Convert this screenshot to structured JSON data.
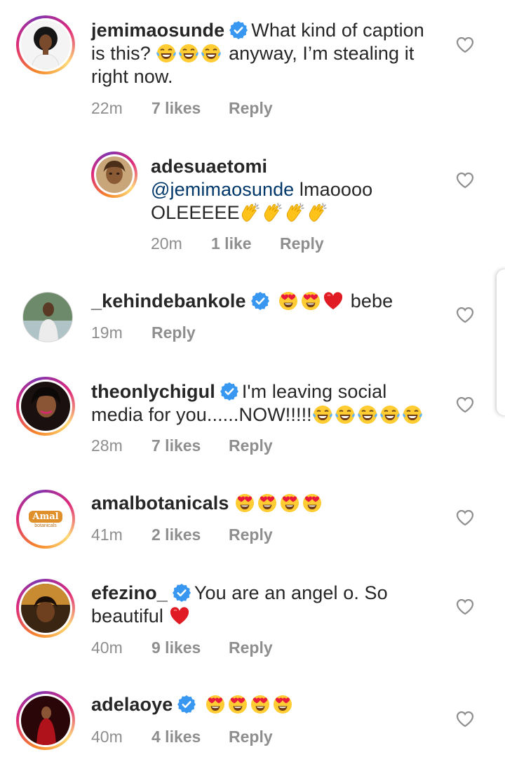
{
  "comments": [
    {
      "username": "jemimaosunde",
      "verified": true,
      "text": "What kind of caption is this? 😂😂😂 anyway, I’m stealing it right now.",
      "text_line1": "What kind of caption",
      "text_line2_a": "is this?",
      "text_line2_b": "anyway, I’m stealing it",
      "text_line3": "right now.",
      "time": "22m",
      "likes": "7 likes",
      "reply": "Reply",
      "emojis": [
        "tears-of-joy",
        "tears-of-joy",
        "tears-of-joy"
      ]
    },
    {
      "username": "adesuaetomi",
      "verified": false,
      "mention": "@jemimaosunde",
      "text": "lmaoooo OLEEEEE👏👏👏👏",
      "text_a": " lmaoooo",
      "text_b": "OLEEEEE",
      "time": "20m",
      "likes": "1 like",
      "reply": "Reply",
      "emojis": [
        "clapping",
        "clapping",
        "clapping",
        "clapping"
      ]
    },
    {
      "username": "_kehindebankole",
      "verified": true,
      "text": "😍😍❤️ bebe",
      "text_a": "bebe",
      "time": "19m",
      "likes": "",
      "reply": "Reply",
      "emojis": [
        "heart-eyes",
        "heart-eyes",
        "red-heart"
      ]
    },
    {
      "username": "theonlychigul",
      "verified": true,
      "text": "I'm leaving social media for you......NOW!!!!!😂😂😂😂😂",
      "text_line1": "I'm leaving social",
      "text_line2": "media for you......NOW!!!!!",
      "time": "28m",
      "likes": "7 likes",
      "reply": "Reply",
      "emojis": [
        "tears-of-joy",
        "tears-of-joy",
        "tears-of-joy",
        "tears-of-joy",
        "tears-of-joy"
      ]
    },
    {
      "username": "amalbotanicals",
      "verified": false,
      "text": "😍😍😍😍",
      "avatar_logo_text": "Amal",
      "avatar_logo_sub": "botanicals",
      "time": "41m",
      "likes": "2 likes",
      "reply": "Reply",
      "emojis": [
        "heart-eyes",
        "heart-eyes",
        "heart-eyes",
        "heart-eyes"
      ]
    },
    {
      "username": "efezino_",
      "verified": true,
      "text": "You are an angel o. So beautiful ❤️",
      "text_line1": "You are an angel o. So",
      "text_line2": "beautiful",
      "time": "40m",
      "likes": "9 likes",
      "reply": "Reply",
      "emojis": [
        "red-heart"
      ]
    },
    {
      "username": "adelaoye",
      "verified": true,
      "text": "😍😍😍😍",
      "time": "40m",
      "likes": "4 likes",
      "reply": "Reply",
      "emojis": [
        "heart-eyes",
        "heart-eyes",
        "heart-eyes",
        "heart-eyes"
      ]
    }
  ],
  "icons": {
    "like": "heart-outline-icon",
    "verified": "verified-badge-icon"
  },
  "colors": {
    "verified": "#3897f0",
    "meta": "#8e8e8e",
    "mention": "#00376b",
    "text": "#262626"
  }
}
